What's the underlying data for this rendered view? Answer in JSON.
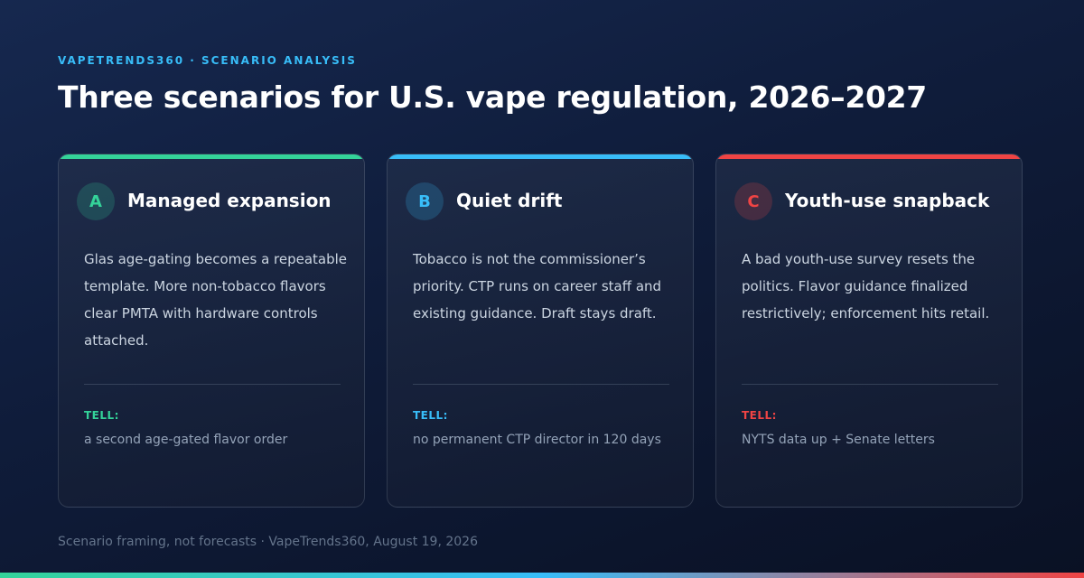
{
  "header": {
    "kicker": "VAPETRENDS360 · SCENARIO ANALYSIS",
    "title": "Three scenarios for U.S. vape regulation, 2026–2027"
  },
  "scenarios": [
    {
      "letter": "A",
      "title": "Managed expansion",
      "body": "Glas age-gating becomes a repeatable template. More non-tobacco flavors clear PMTA with hardware controls attached.",
      "tell_label": "TELL:",
      "tell_text": "a second age-gated flavor order",
      "accent": "#34d399"
    },
    {
      "letter": "B",
      "title": "Quiet drift",
      "body": "Tobacco is not the commissioner’s priority. CTP runs on career staff and existing guidance. Draft stays draft.",
      "tell_label": "TELL:",
      "tell_text": "no permanent CTP director in 120 days",
      "accent": "#38bdf8"
    },
    {
      "letter": "C",
      "title": "Youth-use snapback",
      "body": "A bad youth-use survey resets the politics. Flavor guidance finalized restrictively; enforcement hits retail.",
      "tell_label": "TELL:",
      "tell_text": "NYTS data up + Senate letters",
      "accent": "#ef4444"
    }
  ],
  "footer": {
    "text": "Scenario framing, not forecasts · VapeTrends360, August 19, 2026"
  }
}
